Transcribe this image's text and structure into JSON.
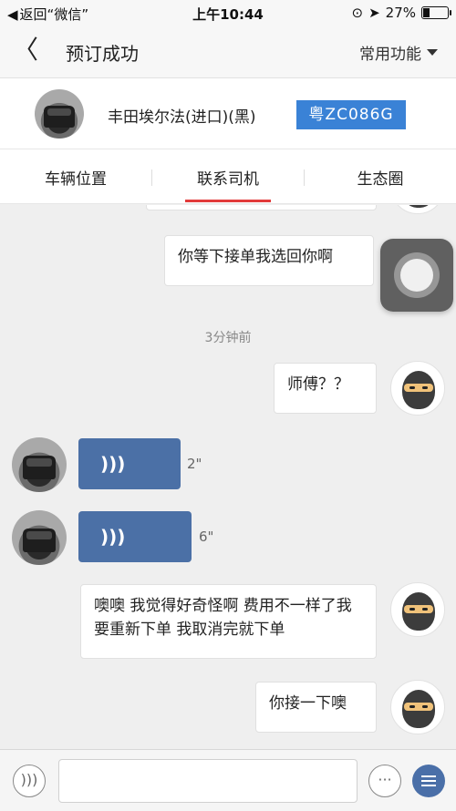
{
  "status_bar": {
    "back_app": "返回“微信”",
    "time": "上午10:44",
    "battery_percent": "27%",
    "battery_level": 0.27
  },
  "nav": {
    "title": "预订成功",
    "menu_label": "常用功能"
  },
  "car": {
    "name": "丰田埃尔法(进口)(黑)",
    "plate": "粤ZC086G"
  },
  "tabs": [
    {
      "label": "车辆位置"
    },
    {
      "label": "联系司机"
    },
    {
      "label": "生态圈"
    }
  ],
  "messages": {
    "m1_text": "你等下接单我选回你啊",
    "timestamp": "3分钟前",
    "m2_text": "师傅？？",
    "voice1_duration": "2\"",
    "voice2_duration": "6\"",
    "m3_text": "噢噢 我觉得好奇怪啊 费用不一样了我要重新下单 我取消完就下单",
    "m4_text": "你接一下噢"
  },
  "colors": {
    "plate_bg": "#3a82d6",
    "tab_indicator": "#e23b3b",
    "voice_bubble": "#4b70a6"
  }
}
